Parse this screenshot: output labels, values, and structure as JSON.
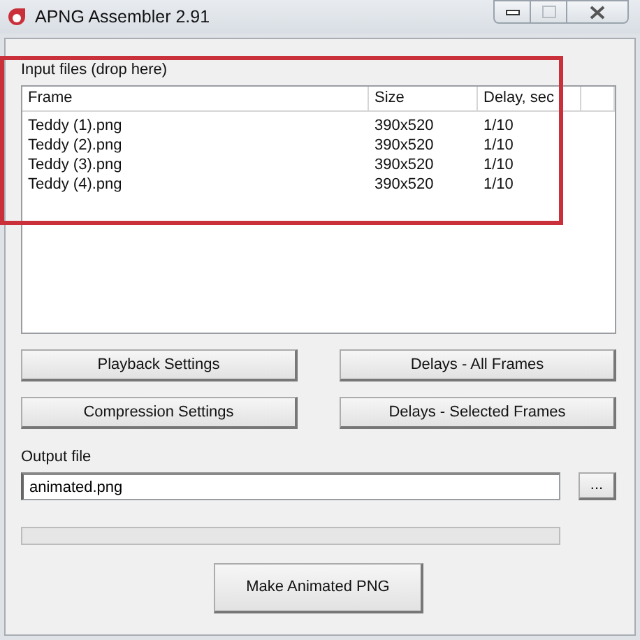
{
  "window": {
    "title": "APNG Assembler 2.91",
    "maximize_disabled": true
  },
  "input_files": {
    "label": "Input files (drop here)",
    "columns": [
      "Frame",
      "Size",
      "Delay, sec"
    ],
    "rows": [
      {
        "frame": "Teddy (1).png",
        "size": "390x520",
        "delay": "1/10"
      },
      {
        "frame": "Teddy (2).png",
        "size": "390x520",
        "delay": "1/10"
      },
      {
        "frame": "Teddy (3).png",
        "size": "390x520",
        "delay": "1/10"
      },
      {
        "frame": "Teddy (4).png",
        "size": "390x520",
        "delay": "1/10"
      }
    ]
  },
  "buttons": [
    [
      "Playback Settings",
      "Delays - All Frames"
    ],
    [
      "Compression Settings",
      "Delays - Selected Frames"
    ]
  ],
  "output": {
    "label": "Output file",
    "value": "animated.png",
    "browse": "..."
  },
  "progress": {
    "level": 0
  },
  "make_button": "Make Animated PNG"
}
